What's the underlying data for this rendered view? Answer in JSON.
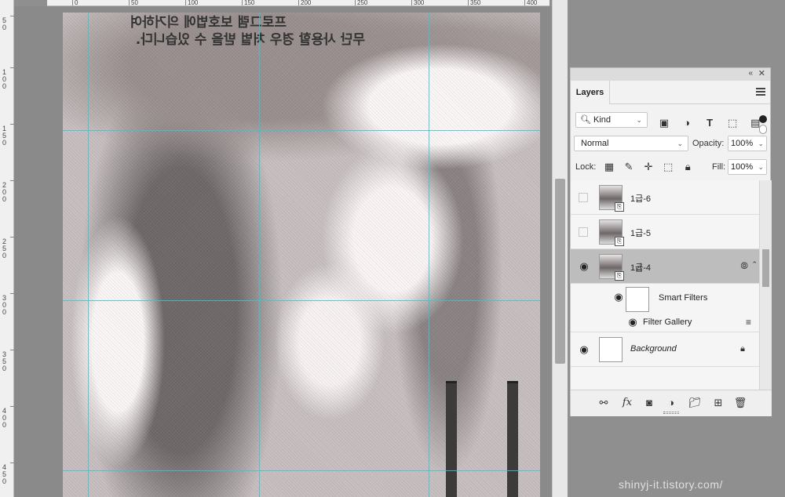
{
  "ruler": {
    "horizontal_ticks": [
      "0",
      "50",
      "100",
      "150",
      "200",
      "250",
      "300",
      "350",
      "400"
    ],
    "vertical_ticks": [
      "50",
      "100",
      "150",
      "200",
      "250",
      "300",
      "350",
      "400",
      "450"
    ]
  },
  "canvas": {
    "mirrored_text_line1": "프로그램 보호법에 의거하여",
    "mirrored_text_line2": "무단 사용할 경우 처벌 받을 수 있습니다."
  },
  "layers_panel": {
    "collapse_icon": "«",
    "close_icon": "✕",
    "tab_label": "Layers",
    "filter_kind": "Kind",
    "blend_mode": "Normal",
    "opacity_label": "Opacity:",
    "opacity_value": "100%",
    "lock_label": "Lock:",
    "fill_label": "Fill:",
    "fill_value": "100%",
    "layers": [
      {
        "name": "1급-6",
        "visible": false
      },
      {
        "name": "1급-5",
        "visible": false
      },
      {
        "name": "1급-4",
        "visible": true,
        "selected": true
      },
      {
        "name": "Background",
        "visible": true,
        "locked": true
      }
    ],
    "smart_filters_label": "Smart Filters",
    "filter_gallery_label": "Filter Gallery"
  },
  "watermark": "shinyj-it.tistory.com/",
  "colors": {
    "guide": "#36c7d6",
    "selected_layer": "#bdbdbd",
    "panel_bg": "#f2f2f2"
  }
}
